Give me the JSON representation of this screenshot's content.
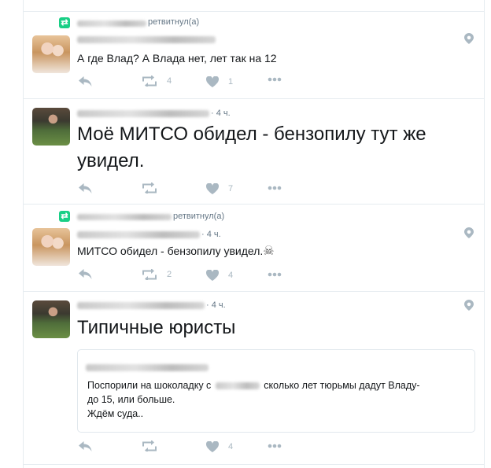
{
  "tweets": [
    {
      "retweet_label": "ретвитнул(а)",
      "time": "",
      "text": "А где Влад? А Влада нет, лет так на 12",
      "actions": {
        "reply": "",
        "retweets": "4",
        "likes": "1"
      }
    },
    {
      "time": "· 4 ч.",
      "text_line1": "Моё МИТСО обидел - бензопилу тут же",
      "text_line2": "увидел.",
      "actions": {
        "reply": "",
        "retweets": "",
        "likes": "7"
      }
    },
    {
      "retweet_label": "ретвитнул(а)",
      "time": "· 4 ч.",
      "text": "МИТСО обидел - бензопилу увидел.",
      "emoji": "☠",
      "actions": {
        "reply": "",
        "retweets": "2",
        "likes": "4"
      }
    },
    {
      "time": "· 4 ч.",
      "text": "Типичные юристы",
      "quote": {
        "line1_before": "Поспорили на шоколадку с",
        "line1_after": "сколько лет тюрьмы дадут Владу-",
        "line2": "до 15, или больше.",
        "line3": "Ждём суда.."
      },
      "actions": {
        "reply": "",
        "retweets": "",
        "likes": "4"
      }
    }
  ],
  "icons": {
    "retweet_badge": "retweet-badge-icon",
    "location": "location-pin-icon",
    "reply": "reply-icon",
    "retweet": "retweet-icon",
    "like": "heart-icon",
    "more": "more-icon"
  },
  "colors": {
    "retweet_green": "#19cf86",
    "icon_gray": "#aab8c2",
    "text": "#14171a",
    "meta": "#657786"
  }
}
